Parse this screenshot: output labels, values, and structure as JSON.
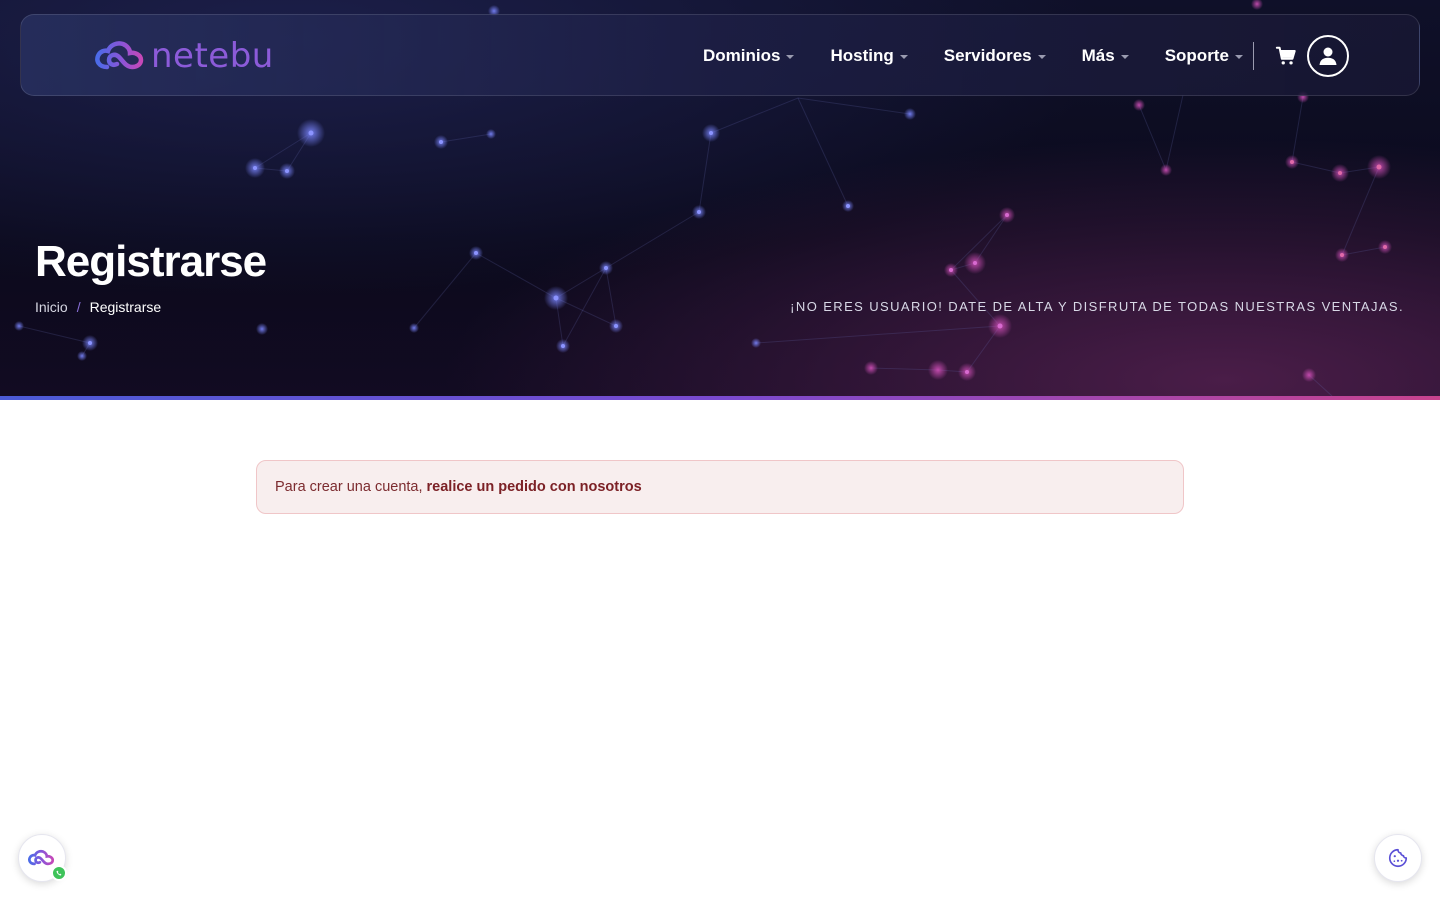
{
  "brand": {
    "name": "netebu"
  },
  "nav": {
    "items": [
      {
        "label": "Dominios"
      },
      {
        "label": "Hosting"
      },
      {
        "label": "Servidores"
      },
      {
        "label": "Más"
      },
      {
        "label": "Soporte"
      }
    ]
  },
  "hero": {
    "title": "Registrarse",
    "breadcrumb": {
      "home": "Inicio",
      "separator": "/",
      "current": "Registrarse"
    },
    "tagline": "¡NO ERES USUARIO! DATE DE ALTA Y DISFRUTA DE TODAS NUESTRAS VENTAJAS."
  },
  "alert": {
    "text": "Para crear una cuenta,",
    "link": "realice un pedido con nosotros"
  },
  "icons": {
    "cart": "shopping-cart-icon",
    "user": "user-circle-icon",
    "whatsapp": "whatsapp-icon",
    "cookie": "cookie-icon",
    "logo": "cloud-logo-icon"
  },
  "colors": {
    "accent_blue": "#4b5bd6",
    "accent_purple": "#8c5bd9",
    "accent_pink": "#c8438e",
    "alert_bg": "#f8eeee",
    "alert_text": "#7c2b2f"
  }
}
